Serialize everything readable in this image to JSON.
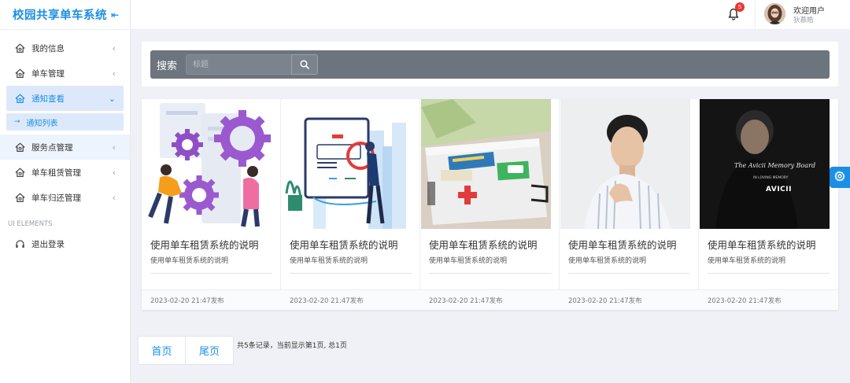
{
  "brand": {
    "title": "校园共享单车系统",
    "toggle_icon": "collapse-left-icon"
  },
  "sidebar": {
    "items": [
      {
        "label": "我的信息",
        "icon": "home-icon"
      },
      {
        "label": "单车管理",
        "icon": "home-icon"
      },
      {
        "label": "通知查看",
        "icon": "home-icon",
        "expanded": true
      },
      {
        "label": "服务点管理",
        "icon": "home-icon"
      },
      {
        "label": "单车租赁管理",
        "icon": "home-icon"
      },
      {
        "label": "单车归还管理",
        "icon": "home-icon"
      }
    ],
    "subitem": {
      "label": "通知列表"
    },
    "section_label": "UI ELEMENTS",
    "logout": {
      "label": "退出登录",
      "icon": "headset-icon"
    }
  },
  "topbar": {
    "notification_count": "5",
    "greeting": "欢迎用户",
    "username": "狄慕皓"
  },
  "search": {
    "label": "搜索",
    "placeholder": "标题"
  },
  "cards": [
    {
      "title": "使用单车租赁系统的说明",
      "desc": "使用单车租赁系统的说明",
      "date": "2023-02-20 21:47发布",
      "image": "gears-illustration"
    },
    {
      "title": "使用单车租赁系统的说明",
      "desc": "使用单车租赁系统的说明",
      "date": "2023-02-20 21:47发布",
      "image": "magnifier-illustration"
    },
    {
      "title": "使用单车租赁系统的说明",
      "desc": "使用单车租赁系统的说明",
      "date": "2023-02-20 21:47发布",
      "image": "first-aid-box-photo"
    },
    {
      "title": "使用单车租赁系统的说明",
      "desc": "使用单车租赁系统的说明",
      "date": "2023-02-20 21:47发布",
      "image": "portrait-photo"
    },
    {
      "title": "使用单车租赁系统的说明",
      "desc": "使用单车租赁系统的说明",
      "date": "2023-02-20 21:47发布",
      "image": "avicii-poster",
      "poster_text": {
        "heading": "The Avicii Memory Board",
        "sub": "IN LOVING MEMORY",
        "logo": "AVICII"
      }
    }
  ],
  "pagination": {
    "first": "首页",
    "last": "尾页",
    "info": "共5条记录，当前显示第1页, 总1页"
  },
  "colors": {
    "accent": "#1b8fe6",
    "search_bar": "#6c757d",
    "badge": "#e8382f"
  }
}
